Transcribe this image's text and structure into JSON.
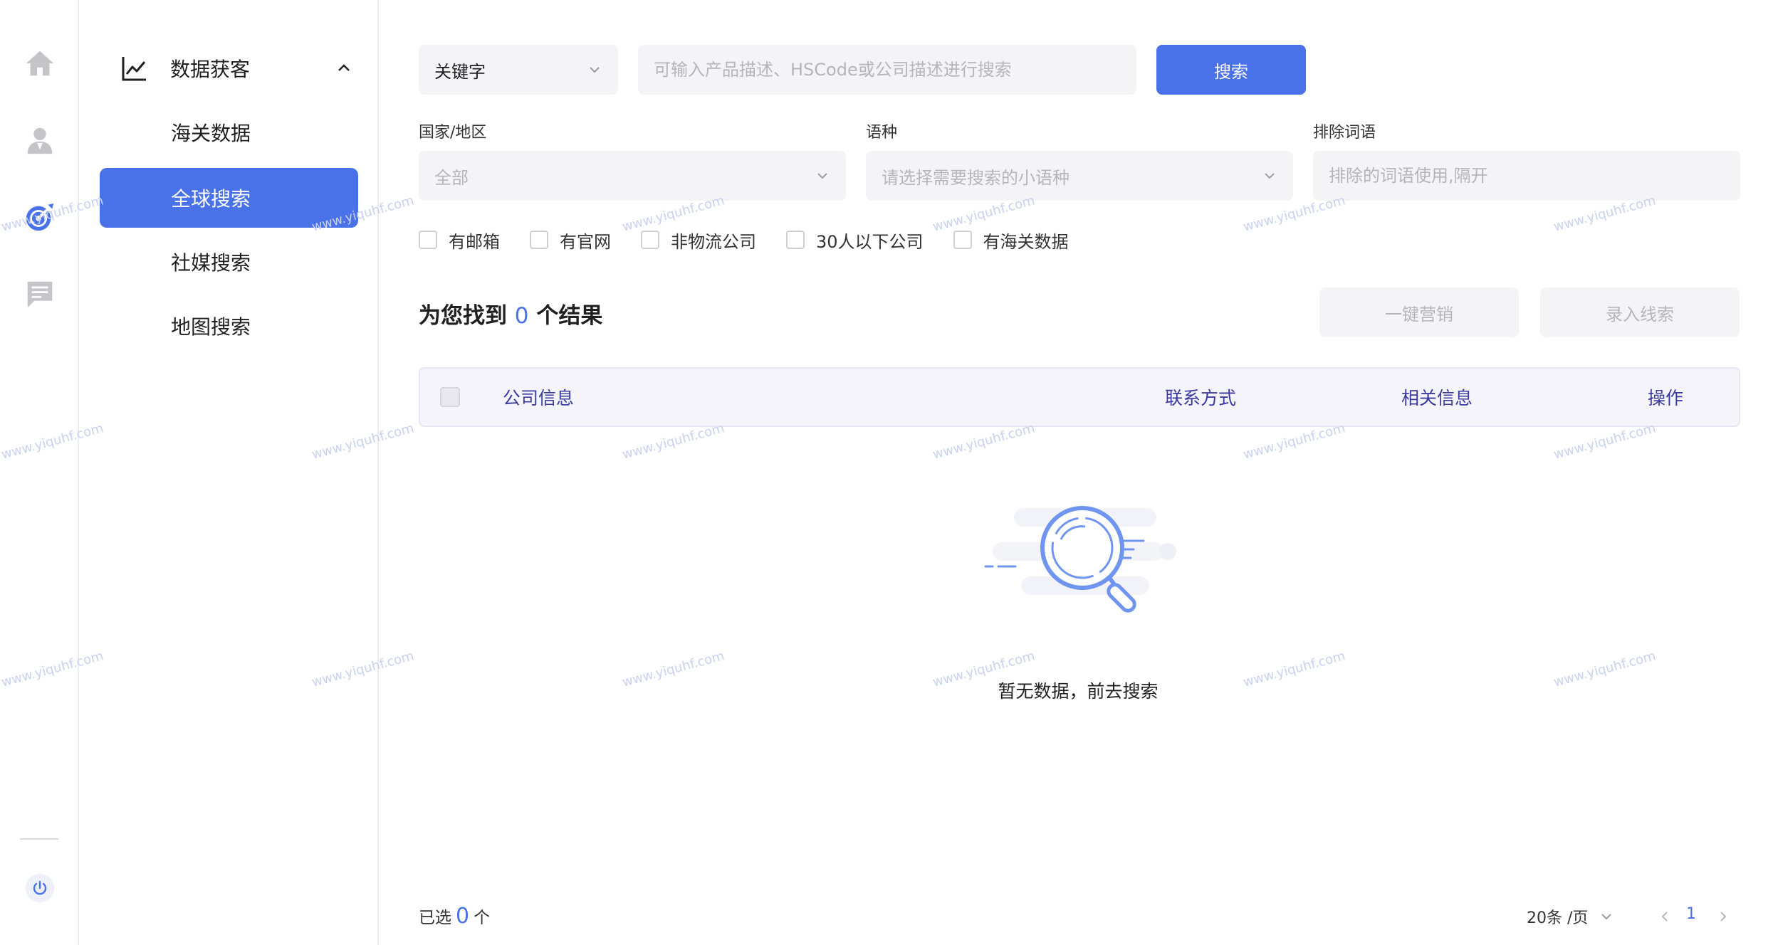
{
  "rail": {
    "icons": [
      "home-icon",
      "user-icon",
      "target-icon",
      "message-icon"
    ],
    "active_color": "#4a72e8",
    "inactive_color": "#c4c4c9"
  },
  "submenu": {
    "group_label": "数据获客",
    "items": [
      {
        "label": "海关数据",
        "active": false
      },
      {
        "label": "全球搜索",
        "active": true
      },
      {
        "label": "社媒搜索",
        "active": false
      },
      {
        "label": "地图搜索",
        "active": false
      }
    ]
  },
  "search": {
    "type_value": "关键字",
    "placeholder": "可输入产品描述、HSCode或公司描述进行搜索",
    "button_label": "搜索"
  },
  "filters": {
    "country_label": "国家/地区",
    "country_value": "全部",
    "language_label": "语种",
    "language_placeholder": "请选择需要搜索的小语种",
    "exclude_label": "排除词语",
    "exclude_placeholder": "排除的词语使用,隔开",
    "checkboxes": [
      "有邮箱",
      "有官网",
      "非物流公司",
      "30人以下公司",
      "有海关数据"
    ]
  },
  "results": {
    "prefix": "为您找到",
    "count": "0",
    "suffix": "个结果",
    "marketing_button": "一键营销",
    "lead_button": "录入线索"
  },
  "table": {
    "columns": [
      "公司信息",
      "联系方式",
      "相关信息",
      "操作"
    ]
  },
  "empty_state": {
    "text": "暂无数据，前去搜索"
  },
  "footer": {
    "selected_prefix": "已选",
    "selected_count": "0",
    "selected_suffix": "个",
    "page_size": "20条 /页",
    "current_page": "1"
  },
  "watermark": "www.yiquhf.com",
  "colors": {
    "accent": "#4a72e8",
    "table_header_text": "#3a3a9e",
    "input_bg": "#f4f4f6"
  }
}
